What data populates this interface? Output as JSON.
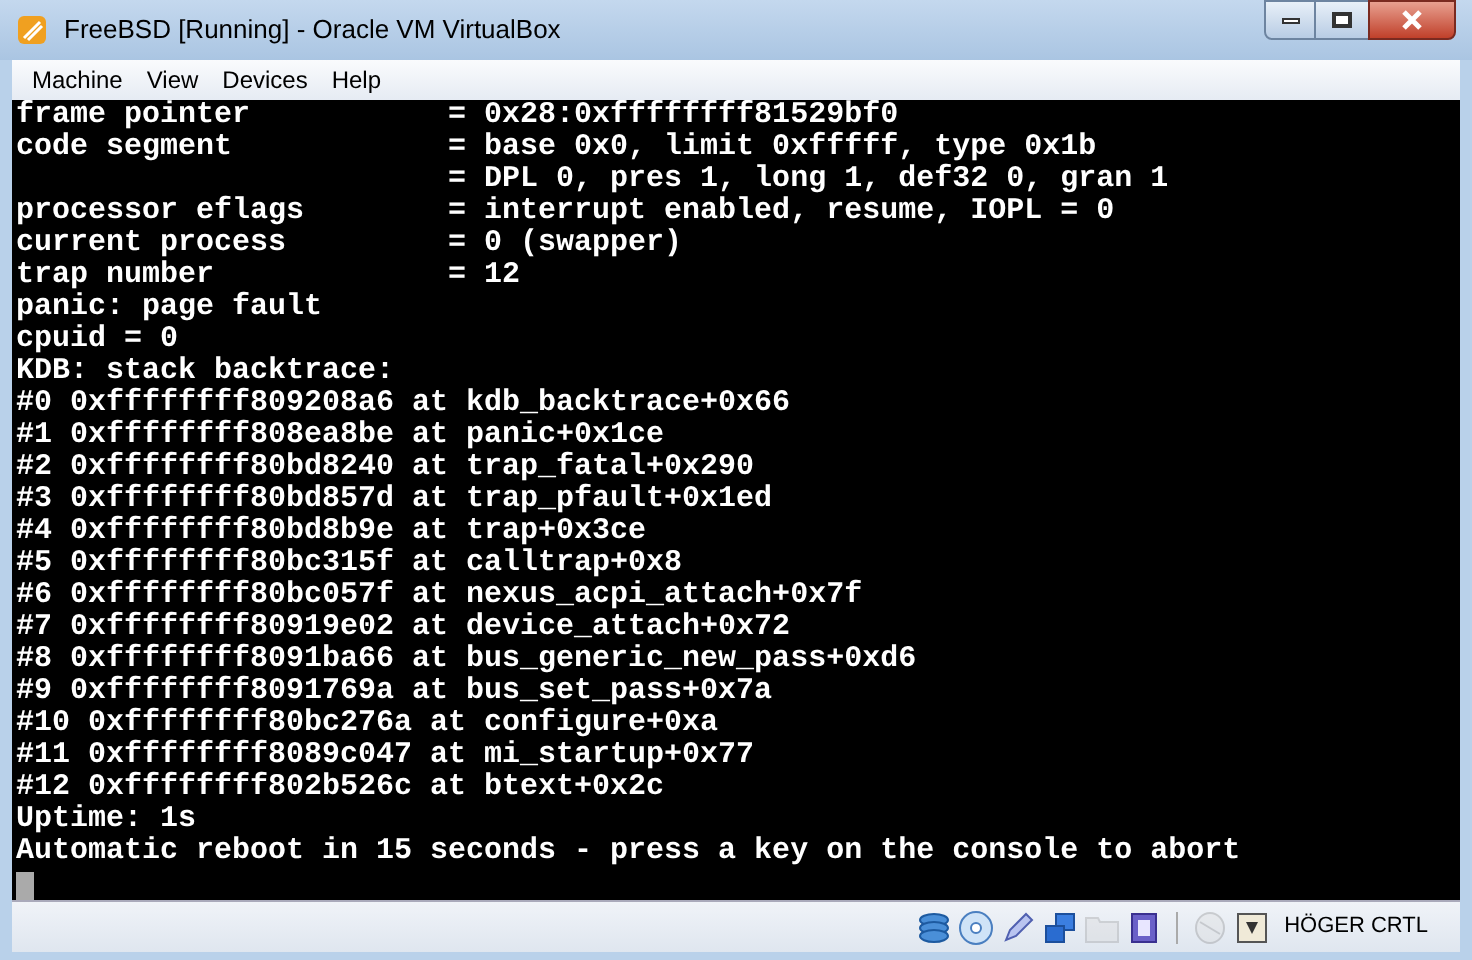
{
  "window": {
    "title": "FreeBSD [Running] - Oracle VM VirtualBox"
  },
  "menu": [
    "Machine",
    "View",
    "Devices",
    "Help"
  ],
  "console": {
    "lines": [
      "frame pointer           = 0x28:0xffffffff81529bf0",
      "code segment            = base 0x0, limit 0xfffff, type 0x1b",
      "                        = DPL 0, pres 1, long 1, def32 0, gran 1",
      "processor eflags        = interrupt enabled, resume, IOPL = 0",
      "current process         = 0 (swapper)",
      "trap number             = 12",
      "panic: page fault",
      "cpuid = 0",
      "KDB: stack backtrace:",
      "#0 0xffffffff809208a6 at kdb_backtrace+0x66",
      "#1 0xffffffff808ea8be at panic+0x1ce",
      "#2 0xffffffff80bd8240 at trap_fatal+0x290",
      "#3 0xffffffff80bd857d at trap_pfault+0x1ed",
      "#4 0xffffffff80bd8b9e at trap+0x3ce",
      "#5 0xffffffff80bc315f at calltrap+0x8",
      "#6 0xffffffff80bc057f at nexus_acpi_attach+0x7f",
      "#7 0xffffffff80919e02 at device_attach+0x72",
      "#8 0xffffffff8091ba66 at bus_generic_new_pass+0xd6",
      "#9 0xffffffff8091769a at bus_set_pass+0x7a",
      "#10 0xffffffff80bc276a at configure+0xa",
      "#11 0xffffffff8089c047 at mi_startup+0x77",
      "#12 0xffffffff802b526c at btext+0x2c",
      "Uptime: 1s",
      "Automatic reboot in 15 seconds - press a key on the console to abort"
    ],
    "cursor": true
  },
  "status_bar": {
    "indicators": [
      {
        "kind": "disk",
        "disabled": false
      },
      {
        "kind": "optical",
        "disabled": false
      },
      {
        "kind": "usb",
        "disabled": false
      },
      {
        "kind": "network",
        "disabled": false
      },
      {
        "kind": "folder",
        "disabled": true
      },
      {
        "kind": "cpu",
        "disabled": false
      },
      {
        "kind": "mouse",
        "disabled": true
      },
      {
        "kind": "hostkey",
        "disabled": false
      }
    ],
    "host_key": "HÖGER CRTL"
  }
}
